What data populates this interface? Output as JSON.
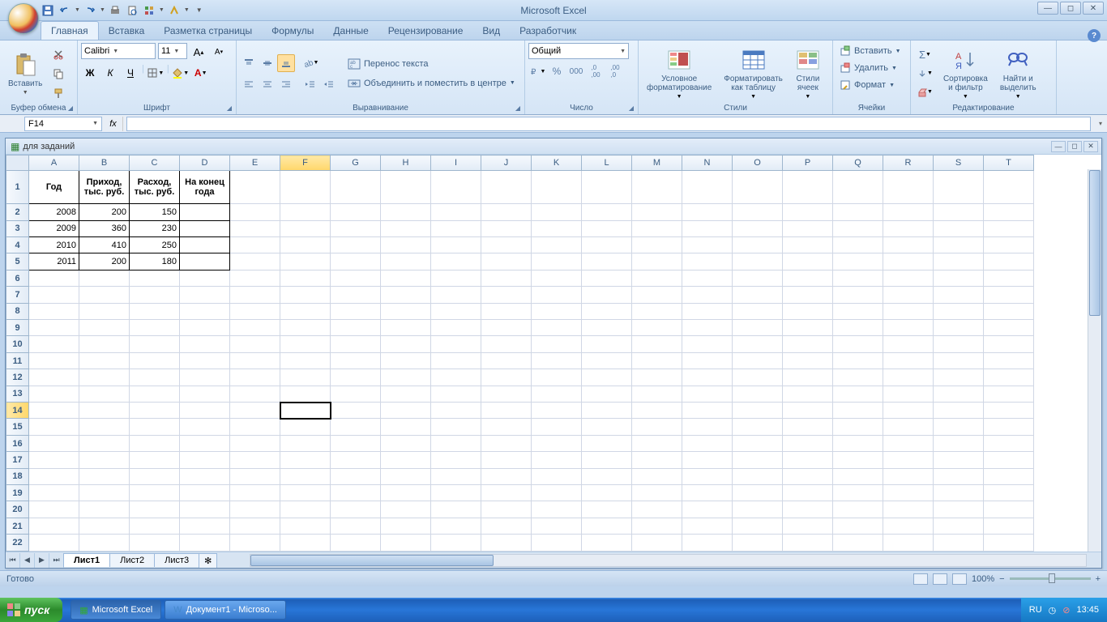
{
  "app_title": "Microsoft Excel",
  "qat_icons": [
    "save",
    "undo",
    "redo",
    "print",
    "preview",
    "spell",
    "macro"
  ],
  "tabs": [
    "Главная",
    "Вставка",
    "Разметка страницы",
    "Формулы",
    "Данные",
    "Рецензирование",
    "Вид",
    "Разработчик"
  ],
  "active_tab": 0,
  "ribbon": {
    "clipboard": {
      "label": "Буфер обмена",
      "paste": "Вставить"
    },
    "font": {
      "label": "Шрифт",
      "name": "Calibri",
      "size": "11",
      "bold": "Ж",
      "italic": "К",
      "underline": "Ч"
    },
    "alignment": {
      "label": "Выравнивание",
      "wrap": "Перенос текста",
      "merge": "Объединить и поместить в центре"
    },
    "number": {
      "label": "Число",
      "format": "Общий"
    },
    "styles": {
      "label": "Стили",
      "conditional": "Условное\nформатирование",
      "table": "Форматировать\nкак таблицу",
      "cell": "Стили\nячеек"
    },
    "cells": {
      "label": "Ячейки",
      "insert": "Вставить",
      "delete": "Удалить",
      "format": "Формат"
    },
    "editing": {
      "label": "Редактирование",
      "sort": "Сортировка\nи фильтр",
      "find": "Найти и\nвыделить"
    }
  },
  "namebox_value": "F14",
  "formula_value": "",
  "doc_title": "для заданий",
  "columns": [
    "A",
    "B",
    "C",
    "D",
    "E",
    "F",
    "G",
    "H",
    "I",
    "J",
    "K",
    "L",
    "M",
    "N",
    "O",
    "P",
    "Q",
    "R",
    "S",
    "T"
  ],
  "col_width_default": 62,
  "selected_cell": {
    "col": "F",
    "row": 14
  },
  "header_row": [
    "Год",
    "Приход,\nтыс. руб.",
    "Расход,\nтыс. руб.",
    "На конец\nгода"
  ],
  "data_rows": [
    {
      "r": 2,
      "cells": [
        "2008",
        "200",
        "150",
        ""
      ]
    },
    {
      "r": 3,
      "cells": [
        "2009",
        "360",
        "230",
        ""
      ]
    },
    {
      "r": 4,
      "cells": [
        "2010",
        "410",
        "250",
        ""
      ]
    },
    {
      "r": 5,
      "cells": [
        "2011",
        "200",
        "180",
        ""
      ]
    }
  ],
  "total_rows": 22,
  "sheets": [
    "Лист1",
    "Лист2",
    "Лист3"
  ],
  "active_sheet": 0,
  "status_text": "Готово",
  "zoom": "100%",
  "taskbar": {
    "start": "пуск",
    "items": [
      {
        "label": "Microsoft Excel",
        "active": true
      },
      {
        "label": "Документ1 - Microso...",
        "active": false
      }
    ],
    "lang": "RU",
    "time": "13:45"
  }
}
